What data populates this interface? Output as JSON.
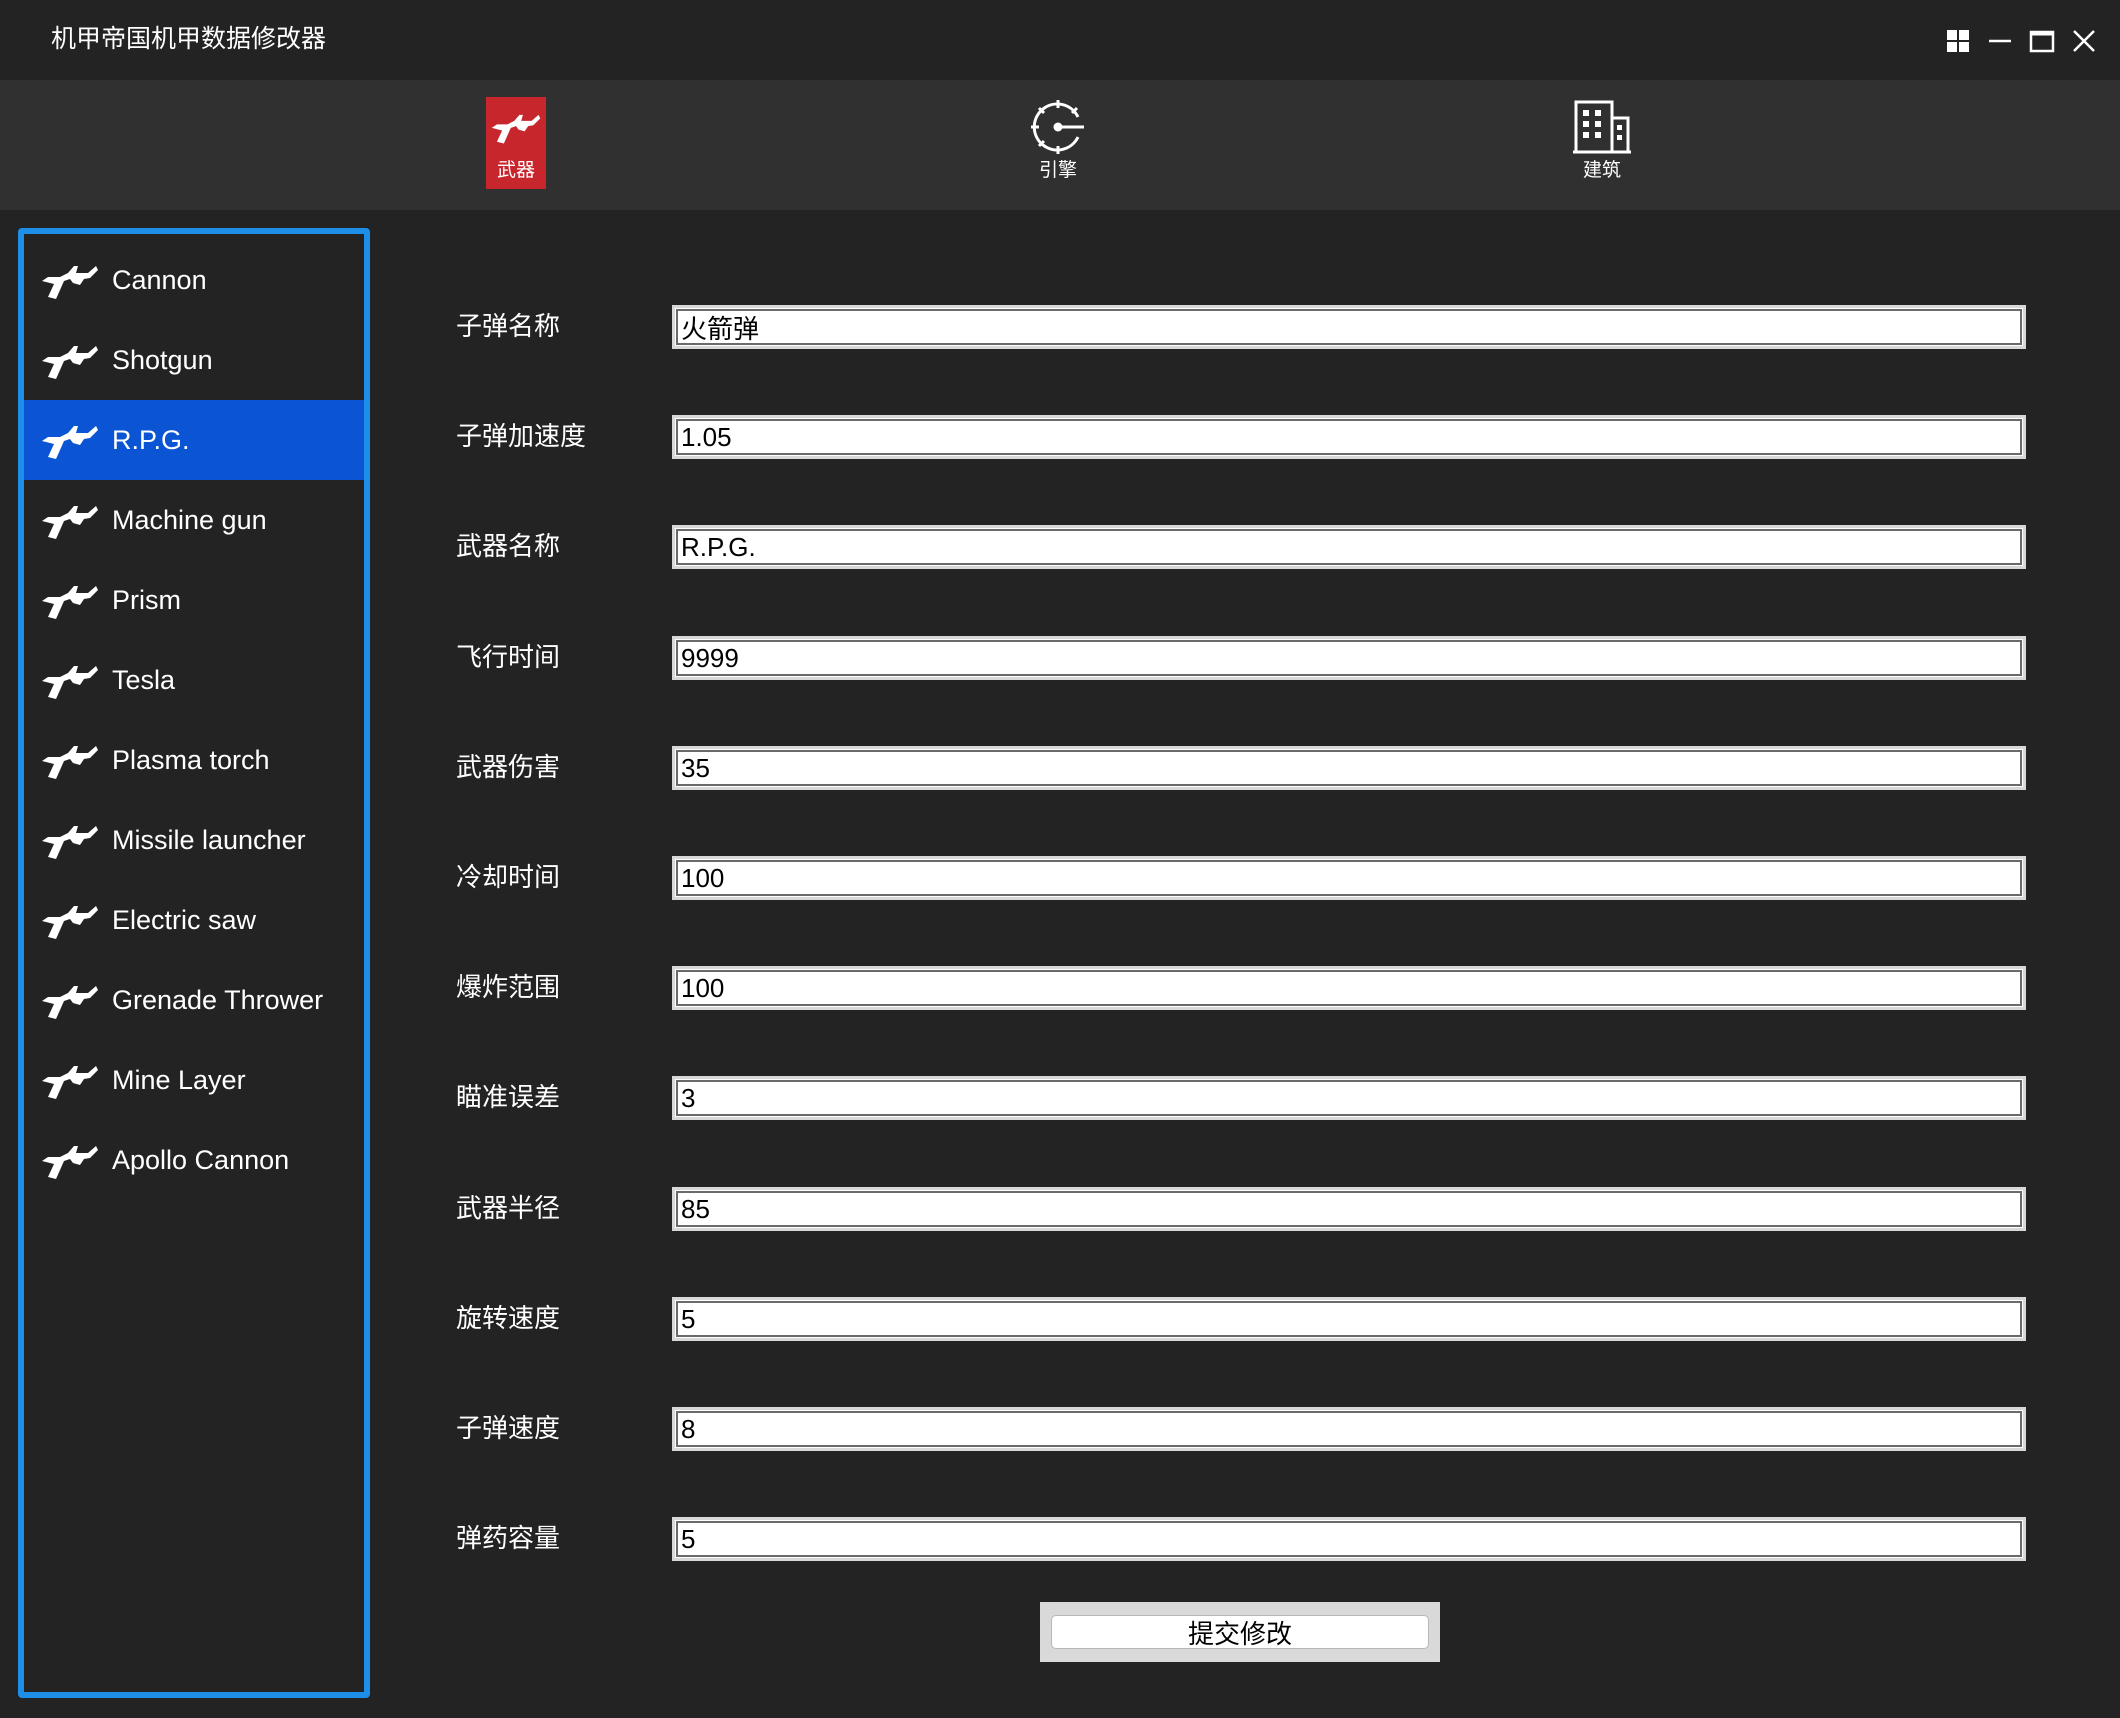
{
  "app": {
    "title": "机甲帝国机甲数据修改器"
  },
  "window_controls": [
    {
      "name": "grid-icon"
    },
    {
      "name": "minimize-icon"
    },
    {
      "name": "maximize-icon"
    },
    {
      "name": "close-icon"
    }
  ],
  "tabs": [
    {
      "id": "weapons",
      "label": "武器",
      "icon": "rifle-icon",
      "active": true
    },
    {
      "id": "engines",
      "label": "引擎",
      "icon": "engine-icon",
      "active": false
    },
    {
      "id": "buildings",
      "label": "建筑",
      "icon": "building-icon",
      "active": false
    }
  ],
  "weapons": [
    {
      "label": "Cannon",
      "icon": "rifle-icon",
      "selected": false
    },
    {
      "label": "Shotgun",
      "icon": "rifle-icon",
      "selected": false
    },
    {
      "label": "R.P.G.",
      "icon": "rifle-icon",
      "selected": true
    },
    {
      "label": "Machine gun",
      "icon": "rifle-icon",
      "selected": false
    },
    {
      "label": "Prism",
      "icon": "rifle-icon",
      "selected": false
    },
    {
      "label": "Tesla",
      "icon": "rifle-icon",
      "selected": false
    },
    {
      "label": "Plasma torch",
      "icon": "rifle-icon",
      "selected": false
    },
    {
      "label": "Missile launcher",
      "icon": "rifle-icon",
      "selected": false
    },
    {
      "label": "Electric saw",
      "icon": "rifle-icon",
      "selected": false
    },
    {
      "label": "Grenade Thrower",
      "icon": "rifle-icon",
      "selected": false
    },
    {
      "label": "Mine Layer",
      "icon": "rifle-icon",
      "selected": false
    },
    {
      "label": "Apollo Cannon",
      "icon": "rifle-icon",
      "selected": false
    }
  ],
  "fields": [
    {
      "label": "子弹名称",
      "value": "火箭弹"
    },
    {
      "label": "子弹加速度",
      "value": "1.05"
    },
    {
      "label": "武器名称",
      "value": "R.P.G."
    },
    {
      "label": "飞行时间",
      "value": "9999"
    },
    {
      "label": "武器伤害",
      "value": "35"
    },
    {
      "label": "冷却时间",
      "value": "100"
    },
    {
      "label": "爆炸范围",
      "value": "100"
    },
    {
      "label": "瞄准误差",
      "value": "3"
    },
    {
      "label": "武器半径",
      "value": "85"
    },
    {
      "label": "旋转速度",
      "value": "5"
    },
    {
      "label": "子弹速度",
      "value": "8"
    },
    {
      "label": "弹药容量",
      "value": "5"
    }
  ],
  "submit_label": "提交修改",
  "colors": {
    "background": "#232323",
    "nav_bar": "#303030",
    "active_tab": "#c8262d",
    "sidebar_border": "#1e8fe8",
    "selected_item": "#0b55d4"
  }
}
